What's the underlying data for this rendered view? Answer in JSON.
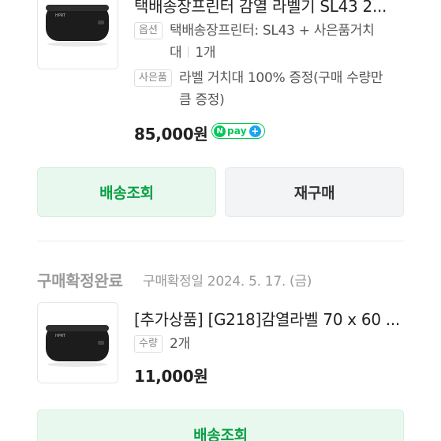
{
  "order1": {
    "title": "택배송장프린터 감열 라벨기 SL43 2...",
    "option_tag": "옵션",
    "option_line1": "택배송장프린터: SL43 + 사은품거치",
    "option_line2": "대",
    "quantity": "1개",
    "gift_tag": "사은품",
    "gift_line1": "라벨 거치대 100% 증정(구매 수량만",
    "gift_line2": "큼 증정)",
    "price": "85,000원",
    "npay_n": "N",
    "npay_label": "pay",
    "npay_plus": "+",
    "track_button": "배송조회",
    "rebuy_button": "재구매"
  },
  "order2": {
    "status": "구매확정완료",
    "confirm_date": "구매확정일 2024. 5. 17. (금)",
    "title": "[추가상품] [G218]감열라벨 70 x 60 ...",
    "qty_tag": "수량",
    "quantity": "2개",
    "price": "11,000원",
    "track_button": "배송조회"
  },
  "colors": {
    "accent_green": "#03c75a",
    "button_green_bg": "#e9f8ee",
    "button_green_text": "#0a9f45",
    "npay_plus": "#1ba4ef"
  }
}
